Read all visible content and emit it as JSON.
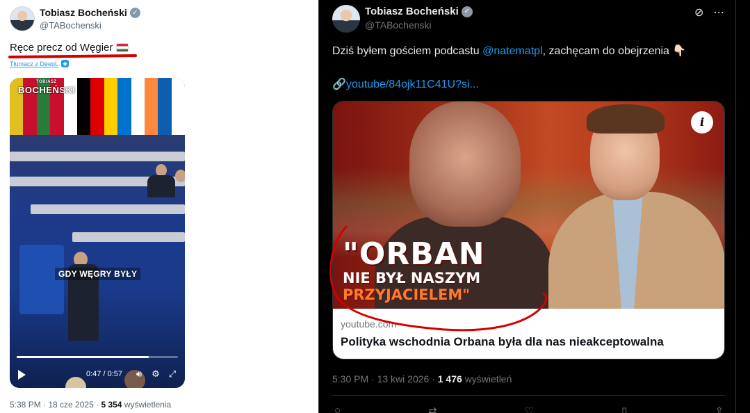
{
  "left_tweet": {
    "author_name": "Tobiasz Bocheński",
    "author_handle": "@TABochenski",
    "text": "Ręce precz od Węgier",
    "translate_label": "Tłumacz z DeepL",
    "video": {
      "overlay_logo": "BOCHEŃSKI",
      "overlay_logo_small": "TOBIASZ",
      "caption": "GDY WĘGRY BYŁY",
      "time": "0:47 / 0:57",
      "progress": 0.82
    },
    "timestamp": "5:38 PM · 18 cze 2025",
    "views_count": "5 354",
    "views_label": "wyświetlenia"
  },
  "right_tweet": {
    "author_name": "Tobiasz Bocheński",
    "author_handle": "@TABochenski",
    "text_before": "Dziś byłem gościem podcastu ",
    "mention": "@natematpl",
    "text_after": ", zachęcam do obejrzenia 👇🏻",
    "link_icon": "🔗",
    "link_text": "youtube/84ojk11C41U?si...",
    "card": {
      "thumb_line1": "\"ORBAN",
      "thumb_line2": "NIE BYŁ NASZYM",
      "thumb_line3": "PRZYJACIELEM\"",
      "domain": "youtube.com",
      "title": "Polityka wschodnia Orbana była dla nas nieakceptowalna"
    },
    "timestamp": "5:30 PM · 13 kwi 2026 · ",
    "views_count": "1 476",
    "views_label": "wyświetleń"
  },
  "colors": {
    "accent_link": "#1d9bf0",
    "annotation_red": "#d40000",
    "dark_bg": "#000000"
  },
  "icons": {
    "verified": "verified-badge-icon",
    "grok": "grok-icon",
    "more": "more-dots-icon",
    "info": "info-icon"
  }
}
